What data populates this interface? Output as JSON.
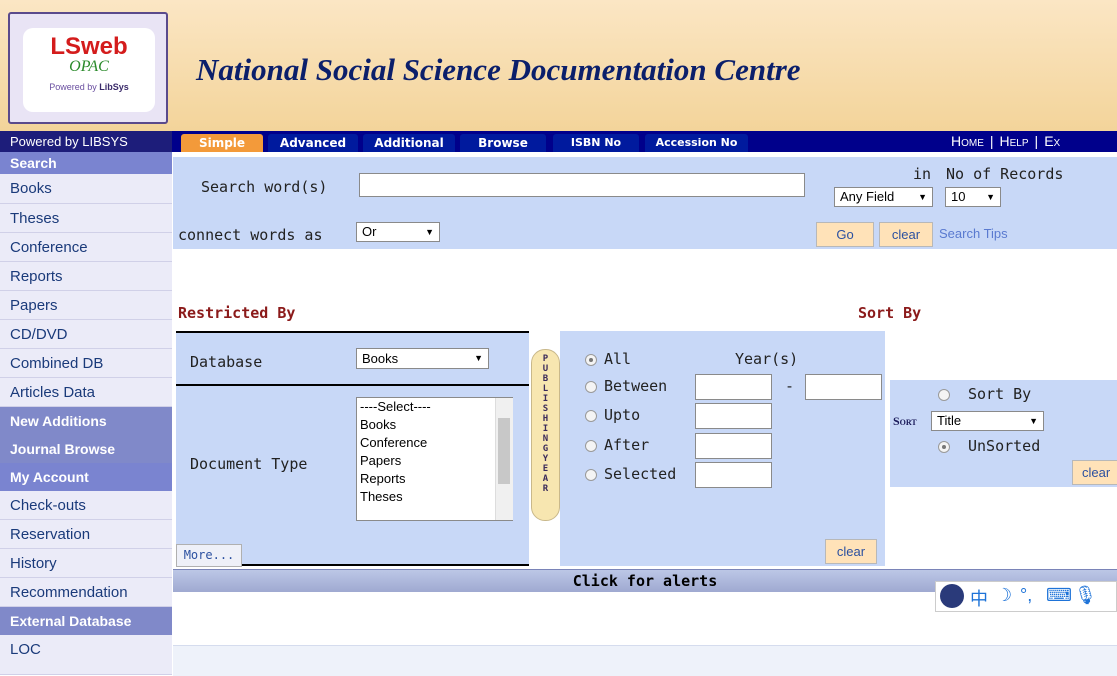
{
  "logo": {
    "main": "LSweb",
    "sub": "OPAC",
    "powered_prefix": "Powered by",
    "powered_brand": "LibSys"
  },
  "site_title": "National Social Science Documentation Centre",
  "topbar": {
    "powered_label": "Powered by LIBSYS",
    "tabs": [
      "Simple",
      "Advanced",
      "Additional",
      "Browse",
      "ISBN No",
      "Accession No"
    ],
    "links": [
      "Home",
      "Help",
      "Ex"
    ]
  },
  "sidebar": {
    "search_head": "Search",
    "search_items": [
      "Books",
      "Theses",
      "Conference",
      "Reports",
      "Papers",
      "CD/DVD",
      "Combined DB",
      "Articles Data"
    ],
    "new_additions": "New Additions",
    "journal_browse": "Journal Browse",
    "my_account_head": "My Account",
    "account_items": [
      "Check-outs",
      "Reservation",
      "History",
      "Recommendation"
    ],
    "external_head": "External Database",
    "external_items": [
      "LOC"
    ]
  },
  "search": {
    "label": "Search word(s)",
    "value": "",
    "connect_label": "connect words as",
    "connect_value": "Or",
    "in_label": "in",
    "records_label": "No of Records",
    "field_value": "Any Field",
    "records_value": "10",
    "go_label": "Go",
    "clear_label": "clear",
    "tips_label": "Search Tips"
  },
  "restricted": {
    "heading": "Restricted By",
    "database_label": "Database",
    "database_value": "Books",
    "doctype_label": "Document Type",
    "doctype_options": [
      "----Select----",
      "Books",
      "Conference",
      "Papers",
      "Reports",
      "Theses"
    ],
    "more_label": "More..."
  },
  "year": {
    "vertical_label": "PUBLISHING YEAR",
    "year_label": "Year(s)",
    "options": [
      "All",
      "Between",
      "Upto",
      "After",
      "Selected"
    ],
    "selected": "All",
    "dash": "-",
    "clear_label": "clear"
  },
  "sort": {
    "heading": "Sort By",
    "sort_by_label": "Sort By",
    "sort_prefix": "Sort",
    "sort_value": "Title",
    "unsorted_label": "UnSorted",
    "clear_label": "clear"
  },
  "alerts": {
    "label": "Click for alerts"
  },
  "colors": {
    "nav": "#00008b",
    "panel": "#c8d8f7",
    "accent": "#f39a3a",
    "sidebar_head": "#7a84d0"
  }
}
